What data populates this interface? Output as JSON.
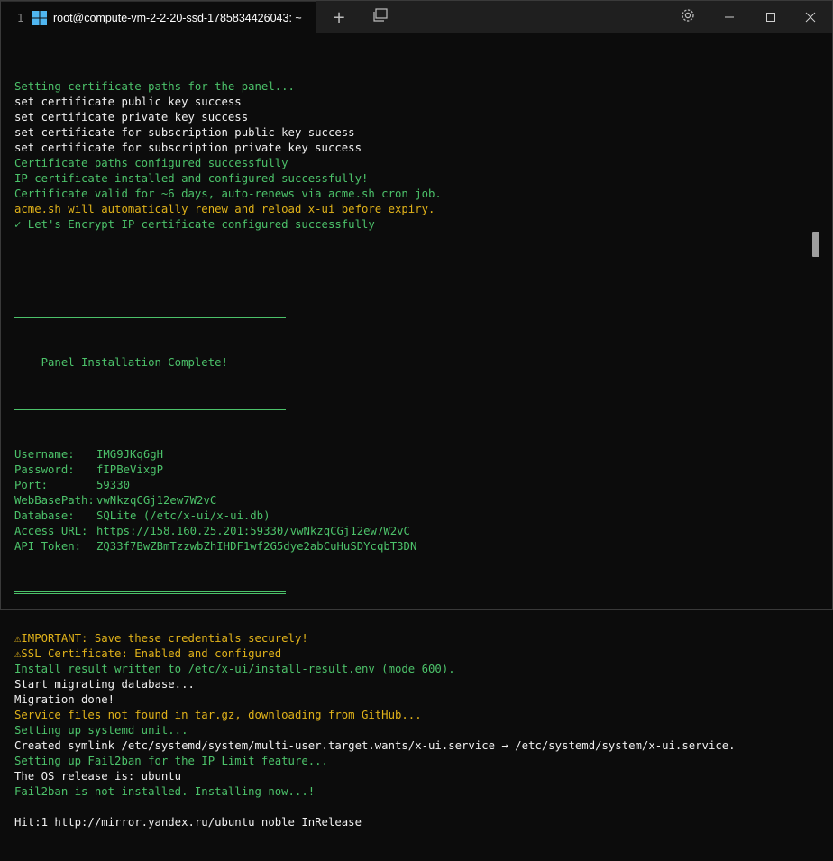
{
  "window": {
    "tab_number": "1",
    "tab_title": "root@compute-vm-2-2-20-ssd-1785834426043: ~",
    "tab_close": "✕",
    "new_tab": "+",
    "dropdown": "⧉",
    "settings": "⚙",
    "minimize": "—",
    "maximize": "☐",
    "close": "✕"
  },
  "terminal": {
    "cert_lines": [
      {
        "text": "Setting certificate paths for the panel...",
        "color": "green"
      },
      {
        "text": "set certificate public key success",
        "color": "white"
      },
      {
        "text": "set certificate private key success",
        "color": "white"
      },
      {
        "text": "set certificate for subscription public key success",
        "color": "white"
      },
      {
        "text": "set certificate for subscription private key success",
        "color": "white"
      },
      {
        "text": "Certificate paths configured successfully",
        "color": "green"
      },
      {
        "text": "IP certificate installed and configured successfully!",
        "color": "green"
      },
      {
        "text": "Certificate valid for ~6 days, auto-renews via acme.sh cron job.",
        "color": "green"
      },
      {
        "text": "acme.sh will automatically renew and reload x-ui before expiry.",
        "color": "yellow"
      },
      {
        "text": "✓ Let's Encrypt IP certificate configured successfully",
        "color": "green"
      }
    ],
    "panel_heading": "    Panel Installation Complete!",
    "credentials": [
      {
        "key": "Username:",
        "value": "IMG9JKq6gH"
      },
      {
        "key": "Password:",
        "value": "fIPBeVixgP"
      },
      {
        "key": "Port:",
        "value": "59330"
      },
      {
        "key": "WebBasePath:",
        "value": "vwNkzqCGj12ew7W2vC"
      },
      {
        "key": "Database:",
        "value": "SQLite (/etc/x-ui/x-ui.db)"
      },
      {
        "key": "Access URL:",
        "value": "https://158.160.25.201:59330/vwNkzqCGj12ew7W2vC"
      },
      {
        "key": "API Token:",
        "value": "ZQ33f7BwZBmTzzwbZhIHDF1wf2G5dye2abCuHuSDYcqbT3DN"
      }
    ],
    "after_lines": [
      {
        "text": "⚠IMPORTANT: Save these credentials securely!",
        "color": "yellow"
      },
      {
        "text": "⚠SSL Certificate: Enabled and configured",
        "color": "yellow"
      },
      {
        "text": "Install result written to /etc/x-ui/install-result.env (mode 600).",
        "color": "green"
      },
      {
        "text": "Start migrating database...",
        "color": "white"
      },
      {
        "text": "Migration done!",
        "color": "white"
      },
      {
        "text": "Service files not found in tar.gz, downloading from GitHub...",
        "color": "yellow"
      },
      {
        "text": "Setting up systemd unit...",
        "color": "green"
      },
      {
        "text": "Created symlink /etc/systemd/system/multi-user.target.wants/x-ui.service → /etc/systemd/system/x-ui.service.",
        "color": "white"
      },
      {
        "text": "Setting up Fail2ban for the IP Limit feature...",
        "color": "green"
      },
      {
        "text": "The OS release is: ubuntu",
        "color": "white"
      },
      {
        "text": "Fail2ban is not installed. Installing now...!",
        "color": "green"
      },
      {
        "text": "",
        "color": "white"
      },
      {
        "text": "Hit:1 http://mirror.yandex.ru/ubuntu noble InRelease",
        "color": "white"
      }
    ]
  },
  "colors": {
    "green": "#4cc26a",
    "white": "#f0f0f0",
    "yellow": "#e0b21a",
    "background": "#0c0c0c"
  }
}
